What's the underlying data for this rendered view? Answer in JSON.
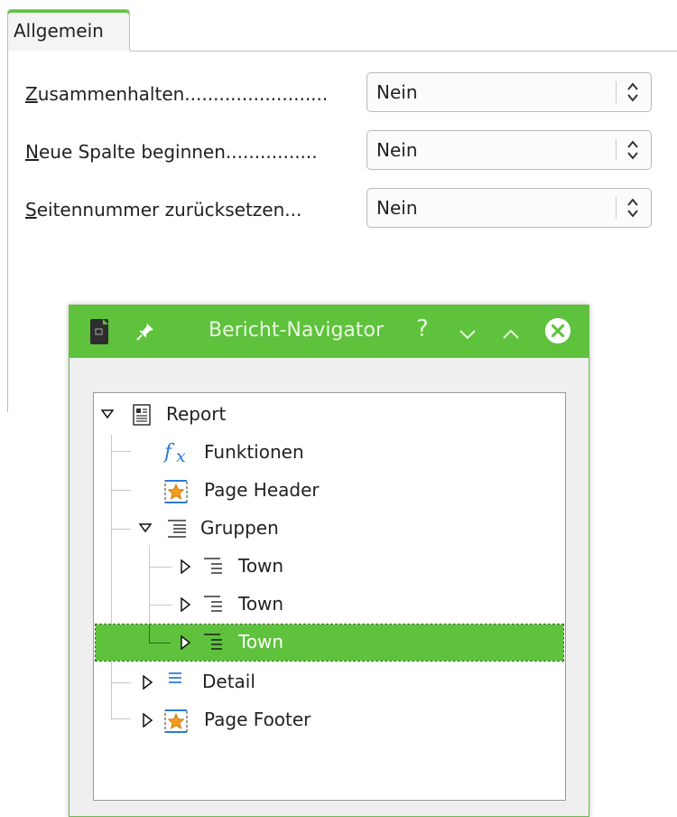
{
  "tab": {
    "label": "Allgemein"
  },
  "properties": [
    {
      "mnemonic": "Z",
      "rest": "usammenhalten.........................",
      "value": "Nein"
    },
    {
      "mnemonic": "N",
      "rest": "eue Spalte beginnen................",
      "value": "Nein"
    },
    {
      "mnemonic": "S",
      "rest": "eitennummer zurücksetzen...",
      "value": "Nein"
    }
  ],
  "navigator": {
    "title": "Bericht-Navigator",
    "help": "?",
    "tree": [
      {
        "label": "Report",
        "icon": "report-icon"
      },
      {
        "label": "Funktionen",
        "icon": "function-icon"
      },
      {
        "label": "Page Header",
        "icon": "page-header-icon"
      },
      {
        "label": "Gruppen",
        "icon": "groups-icon"
      },
      {
        "label": "Town",
        "icon": "group-icon"
      },
      {
        "label": "Town",
        "icon": "group-icon"
      },
      {
        "label": "Town",
        "icon": "group-icon",
        "selected": true
      },
      {
        "label": "Detail",
        "icon": "detail-icon"
      },
      {
        "label": "Page Footer",
        "icon": "page-footer-icon"
      }
    ]
  },
  "colors": {
    "accent": "#5ec23c",
    "function_blue": "#2b7bd6",
    "star_orange": "#f29b1d"
  }
}
